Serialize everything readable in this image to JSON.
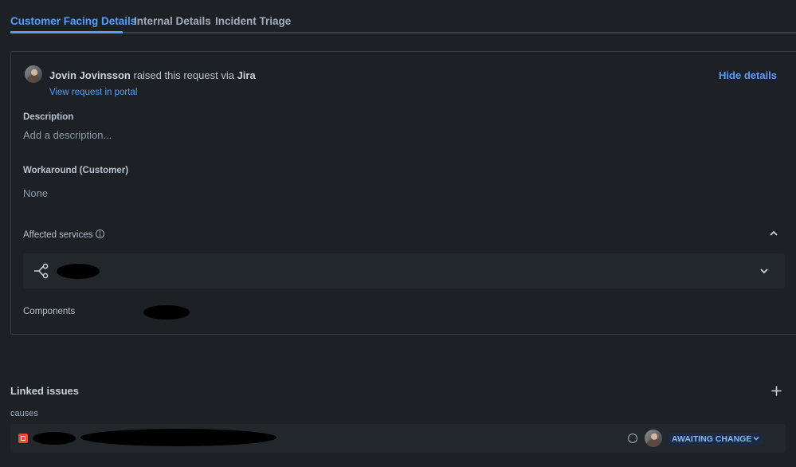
{
  "tabs": [
    {
      "label": "Customer Facing Details",
      "active": true
    },
    {
      "label": "Internal Details",
      "active": false
    },
    {
      "label": "Incident Triage",
      "active": false
    }
  ],
  "details": {
    "reporter_name": "Jovin Jovinsson",
    "raised_text": " raised this request via ",
    "channel": "Jira",
    "portal_link": "View request in portal",
    "hide_details": "Hide details",
    "description_label": "Description",
    "description_placeholder": "Add a description...",
    "workaround_label": "Workaround (Customer)",
    "workaround_value": "None",
    "affected_services_label": "Affected services",
    "components_label": "Components"
  },
  "linked_issues": {
    "title": "Linked issues",
    "relation": "causes",
    "items": [
      {
        "status": "AWAITING CHANGE"
      }
    ]
  },
  "icons": {
    "info": "info-icon",
    "service": "service-graph-icon",
    "chevron_up": "chevron-up-icon",
    "chevron_down": "chevron-down-icon",
    "add": "plus-icon",
    "issue_type": "incident-icon"
  },
  "colors": {
    "background": "#1d2125",
    "accent": "#579dff",
    "surface": "#22272b",
    "border": "#38414a"
  }
}
